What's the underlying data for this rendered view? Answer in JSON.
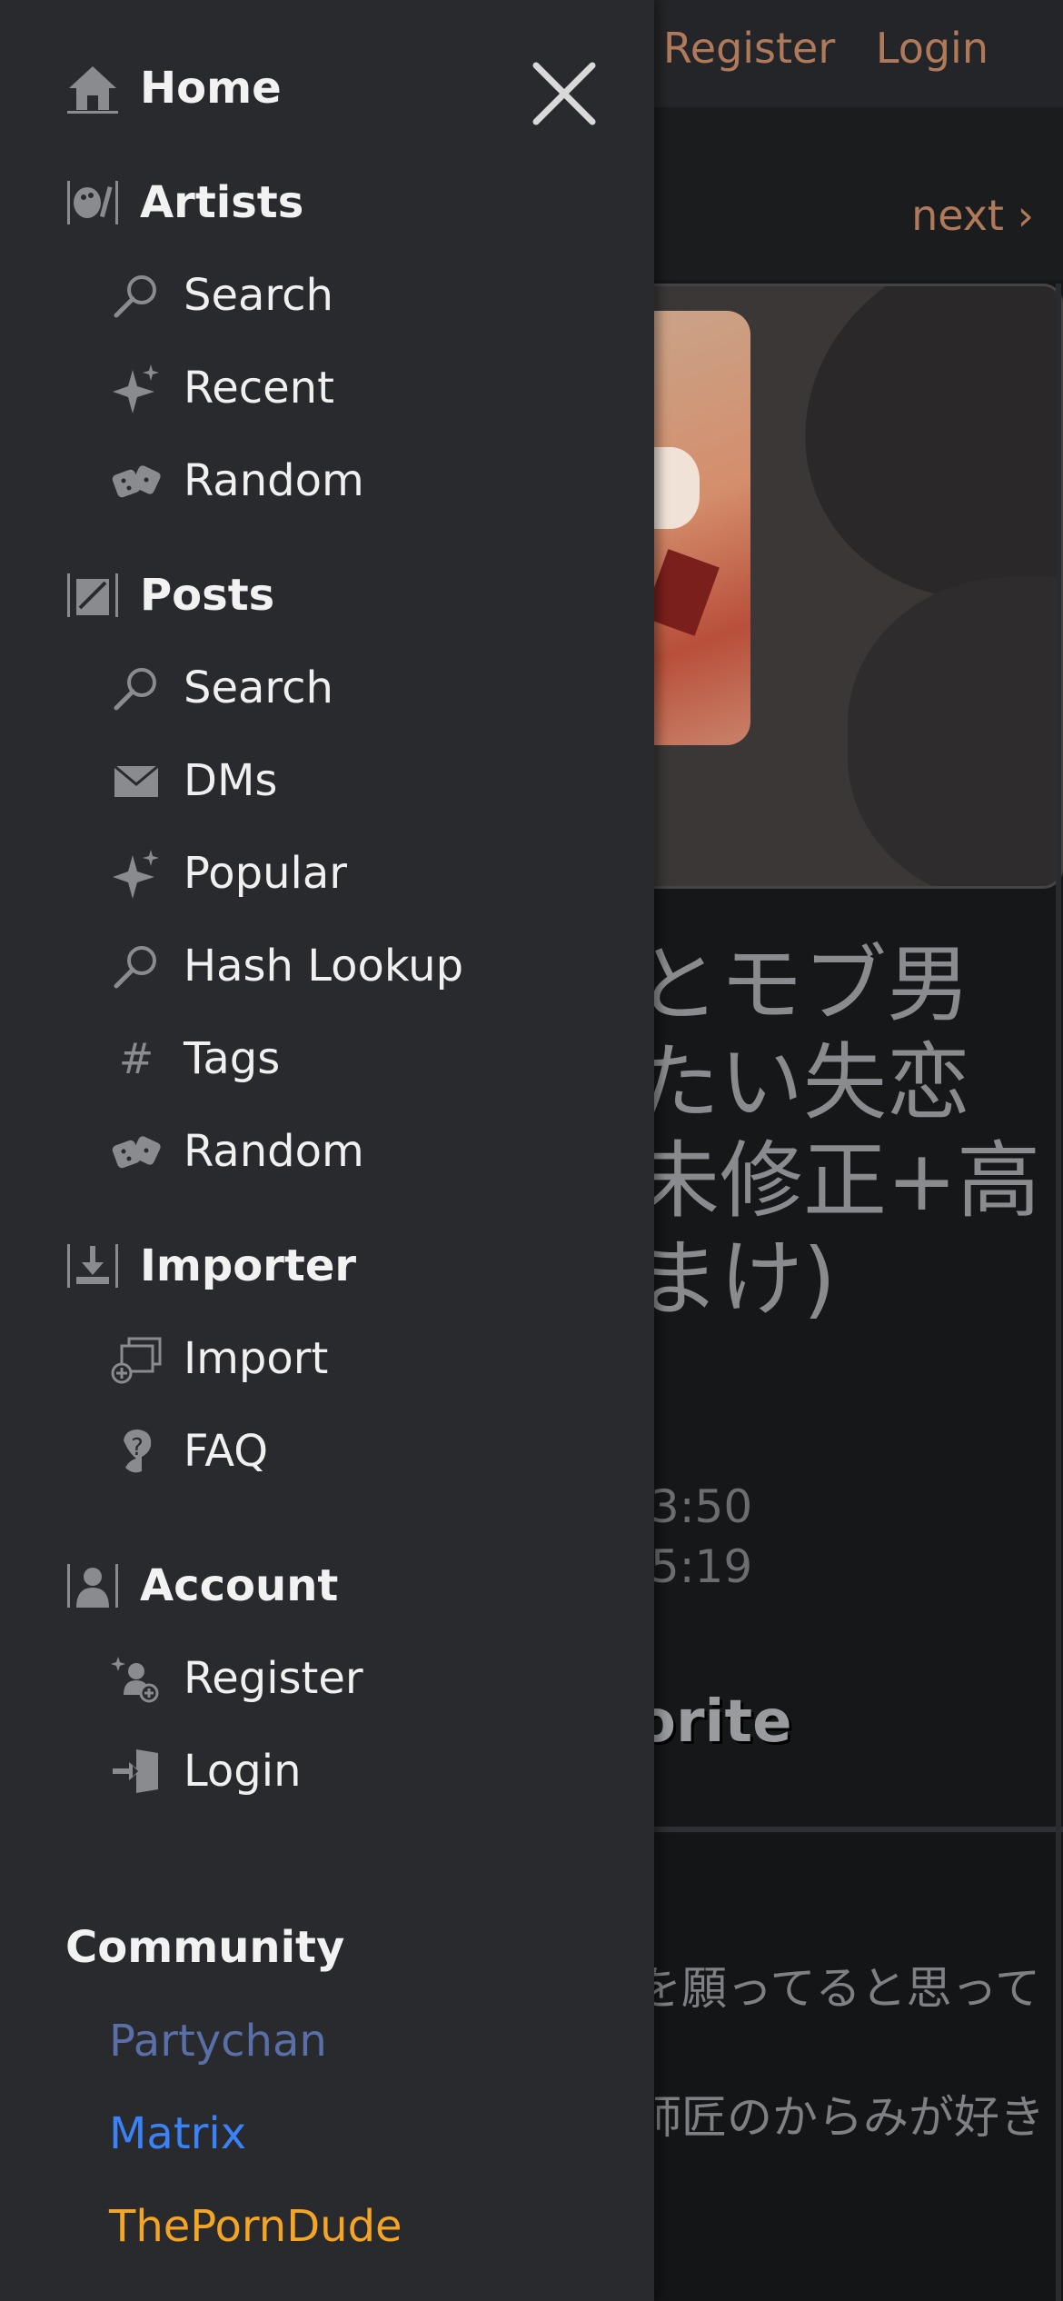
{
  "background": {
    "top_links": [
      "Register",
      "Login"
    ],
    "next_label": "next ›",
    "title_lines": [
      "とモブ男",
      "たい失恋",
      "未修正+高",
      "まけ)"
    ],
    "dates": [
      ".3:50",
      ".5:19"
    ],
    "favorite_label": "orite",
    "content_lines": [
      "を願ってると思って",
      "師匠のからみが好き"
    ]
  },
  "drawer": {
    "sections": [
      {
        "title": "Home",
        "icon": "home-icon",
        "items": []
      },
      {
        "title": "Artists",
        "icon": "palette-icon",
        "items": [
          {
            "label": "Search",
            "icon": "search-icon"
          },
          {
            "label": "Recent",
            "icon": "sparkle-icon"
          },
          {
            "label": "Random",
            "icon": "dice-icon"
          }
        ]
      },
      {
        "title": "Posts",
        "icon": "posts-icon",
        "items": [
          {
            "label": "Search",
            "icon": "search-icon"
          },
          {
            "label": "DMs",
            "icon": "envelope-icon"
          },
          {
            "label": "Popular",
            "icon": "sparkle-icon"
          },
          {
            "label": "Hash Lookup",
            "icon": "search-icon"
          },
          {
            "label": "Tags",
            "icon": "hash-icon"
          },
          {
            "label": "Random",
            "icon": "dice-icon"
          }
        ]
      },
      {
        "title": "Importer",
        "icon": "import-icon",
        "items": [
          {
            "label": "Import",
            "icon": "import-computer-icon"
          },
          {
            "label": "FAQ",
            "icon": "faq-icon"
          }
        ]
      },
      {
        "title": "Account",
        "icon": "account-icon",
        "items": [
          {
            "label": "Register",
            "icon": "register-icon"
          },
          {
            "label": "Login",
            "icon": "login-icon"
          }
        ]
      }
    ],
    "community": {
      "title": "Community",
      "links": [
        {
          "label": "Partychan",
          "color": "#5a6fa8"
        },
        {
          "label": "Matrix",
          "color": "#3b82f6"
        },
        {
          "label": "ThePornDude",
          "color": "#f5a524"
        }
      ]
    }
  }
}
